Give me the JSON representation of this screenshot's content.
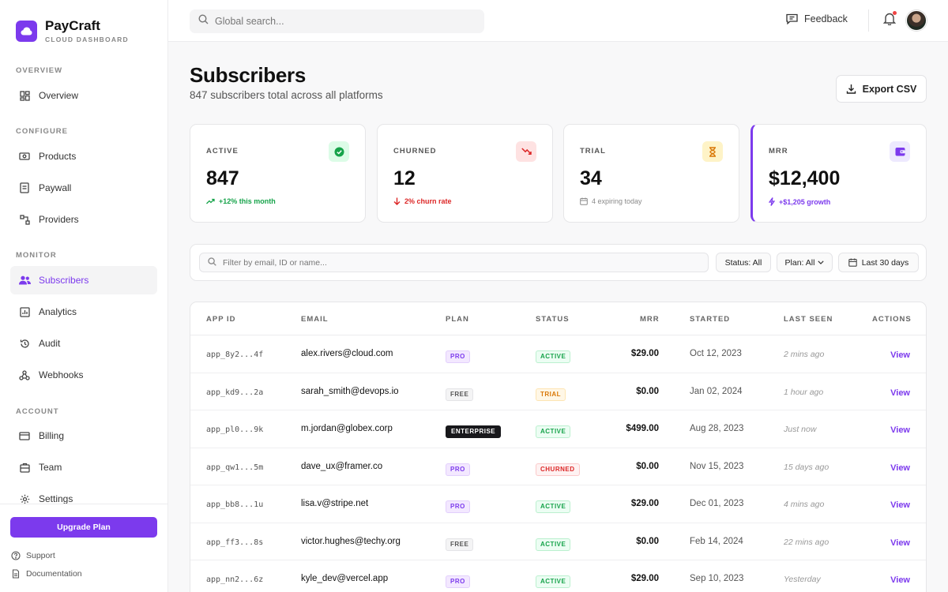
{
  "brand": {
    "name": "PayCraft",
    "subtitle": "CLOUD DASHBOARD"
  },
  "sidebar": {
    "sections": [
      "OVERVIEW",
      "CONFIGURE",
      "MONITOR",
      "ACCOUNT"
    ],
    "items": [
      {
        "label": "Overview",
        "icon": "grid-icon"
      },
      {
        "label": "Products",
        "icon": "products-icon"
      },
      {
        "label": "Paywall",
        "icon": "paywall-icon"
      },
      {
        "label": "Providers",
        "icon": "providers-icon"
      },
      {
        "label": "Subscribers",
        "icon": "users-icon",
        "active": true
      },
      {
        "label": "Analytics",
        "icon": "analytics-icon"
      },
      {
        "label": "Audit",
        "icon": "history-icon"
      },
      {
        "label": "Webhooks",
        "icon": "webhook-icon"
      },
      {
        "label": "Billing",
        "icon": "card-icon"
      },
      {
        "label": "Team",
        "icon": "team-icon"
      },
      {
        "label": "Settings",
        "icon": "gear-icon"
      }
    ],
    "upgrade_label": "Upgrade Plan",
    "support_label": "Support",
    "docs_label": "Documentation"
  },
  "topbar": {
    "search_placeholder": "Global search...",
    "feedback_label": "Feedback"
  },
  "header": {
    "title": "Subscribers",
    "subtitle": "847 subscribers total across all platforms",
    "export_label": "Export CSV"
  },
  "stats": [
    {
      "label": "ACTIVE",
      "value": "847",
      "note": "+12% this month",
      "note_color": "#16a34a"
    },
    {
      "label": "CHURNED",
      "value": "12",
      "note": "2% churn rate",
      "note_color": "#dc2626"
    },
    {
      "label": "TRIAL",
      "value": "34",
      "note": "4 expiring today",
      "note_color": "#8a8a8a"
    },
    {
      "label": "MRR",
      "value": "$12,400",
      "note": "+$1,205 growth",
      "note_color": "#7c3aed"
    }
  ],
  "filters": {
    "search_placeholder": "Filter by email, ID or name...",
    "status_label": "Status: All",
    "plan_label": "Plan: All",
    "range_label": "Last 30 days"
  },
  "table": {
    "columns": [
      "APP ID",
      "EMAIL",
      "PLAN",
      "STATUS",
      "MRR",
      "STARTED",
      "LAST SEEN",
      "ACTIONS"
    ],
    "rows": [
      {
        "id": "app_8y2...4f",
        "email": "alex.rivers@cloud.com",
        "plan": "PRO",
        "status": "ACTIVE",
        "mrr": "$29.00",
        "started": "Oct 12, 2023",
        "seen": "2 mins ago",
        "action": "View"
      },
      {
        "id": "app_kd9...2a",
        "email": "sarah_smith@devops.io",
        "plan": "FREE",
        "status": "TRIAL",
        "mrr": "$0.00",
        "started": "Jan 02, 2024",
        "seen": "1 hour ago",
        "action": "View"
      },
      {
        "id": "app_pl0...9k",
        "email": "m.jordan@globex.corp",
        "plan": "ENTERPRISE",
        "status": "ACTIVE",
        "mrr": "$499.00",
        "started": "Aug 28, 2023",
        "seen": "Just now",
        "action": "View"
      },
      {
        "id": "app_qw1...5m",
        "email": "dave_ux@framer.co",
        "plan": "PRO",
        "status": "CHURNED",
        "mrr": "$0.00",
        "started": "Nov 15, 2023",
        "seen": "15 days ago",
        "action": "View"
      },
      {
        "id": "app_bb8...1u",
        "email": "lisa.v@stripe.net",
        "plan": "PRO",
        "status": "ACTIVE",
        "mrr": "$29.00",
        "started": "Dec 01, 2023",
        "seen": "4 mins ago",
        "action": "View"
      },
      {
        "id": "app_ff3...8s",
        "email": "victor.hughes@techy.org",
        "plan": "FREE",
        "status": "ACTIVE",
        "mrr": "$0.00",
        "started": "Feb 14, 2024",
        "seen": "22 mins ago",
        "action": "View"
      },
      {
        "id": "app_nn2...6z",
        "email": "kyle_dev@vercel.app",
        "plan": "PRO",
        "status": "ACTIVE",
        "mrr": "$29.00",
        "started": "Sep 10, 2023",
        "seen": "Yesterday",
        "action": "View"
      }
    ]
  },
  "colors": {
    "accent": "#7c3aed",
    "success": "#16a34a",
    "danger": "#dc2626",
    "warning": "#d97706"
  }
}
